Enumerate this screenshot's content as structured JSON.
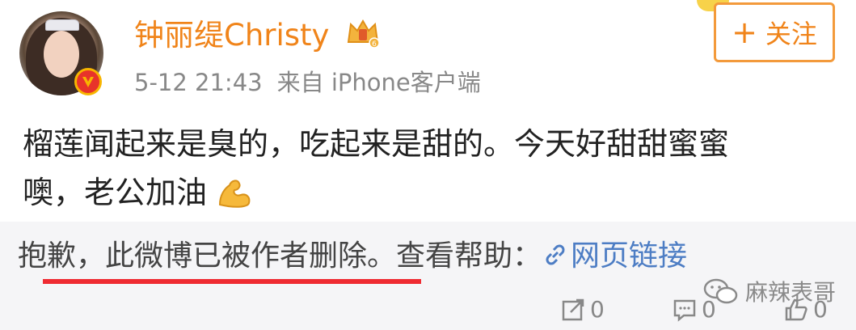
{
  "post": {
    "author_name": "钟丽缇Christy",
    "timestamp": "5-12 21:43",
    "source": "来自 iPhone客户端",
    "follow_label": "关注",
    "follow_plus": "+",
    "content_line1": "榴莲闻起来是臭的，吃起来是甜的。今天好甜甜蜜蜜",
    "content_line2": "噢，老公加油",
    "deleted_notice": "抱歉，此微博已被作者删除。查看帮助：",
    "link_text": "网页链接"
  },
  "actions": {
    "repost_count": "0",
    "comment_count": "0",
    "like_count": "0"
  },
  "watermark": {
    "text": "麻辣表哥"
  },
  "icons": [
    "verified-v-icon",
    "crown-level-icon",
    "plus-icon",
    "muscle-emoji-icon",
    "link-icon",
    "wechat-icon",
    "repost-icon",
    "comment-icon",
    "like-icon"
  ],
  "colors": {
    "accent": "#f0841a",
    "link": "#4d7dc4",
    "underline": "#ef2b32",
    "deleted_bg": "#f5f5f7"
  }
}
